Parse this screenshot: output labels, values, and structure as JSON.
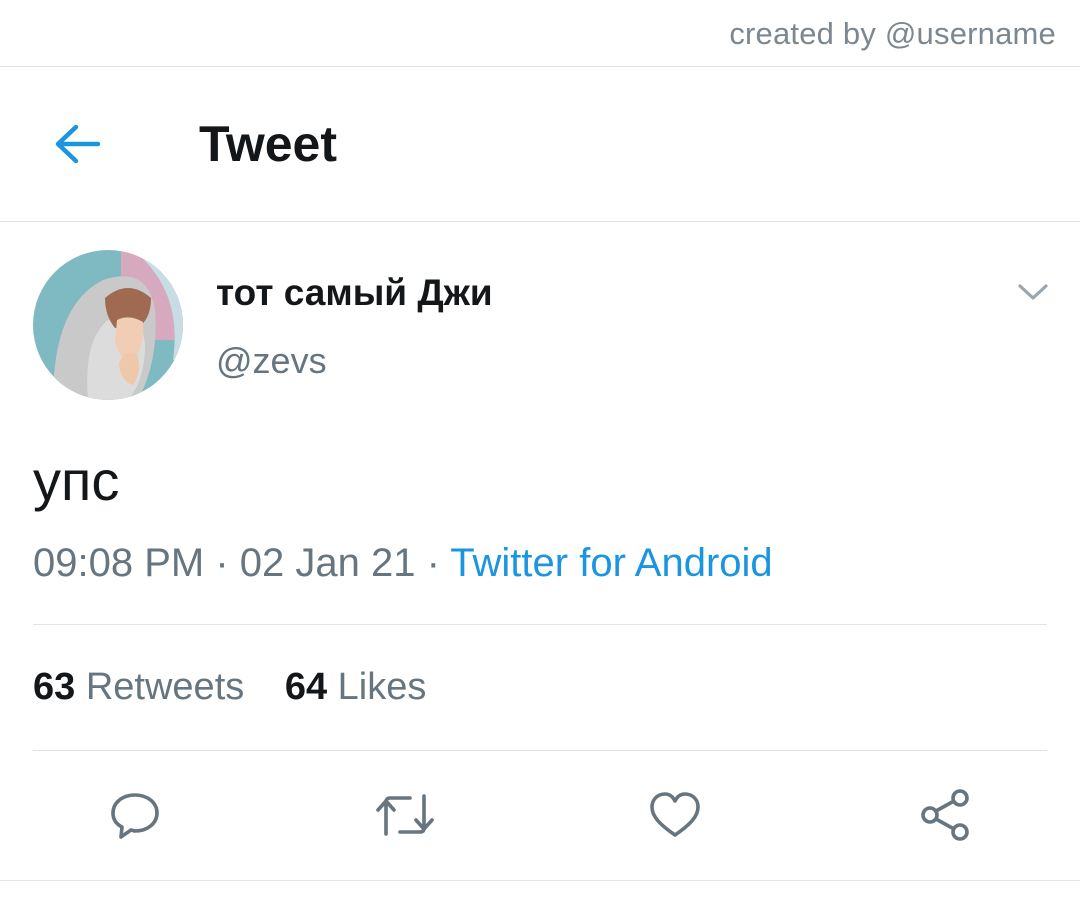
{
  "credit": "created by @username",
  "header": {
    "back_icon": "arrow-left-icon",
    "title": "Tweet"
  },
  "tweet": {
    "author": {
      "display_name": "тот самый Джи",
      "handle": "@zevs",
      "avatar": "profile-photo"
    },
    "text": "упс",
    "time": "09:08 PM",
    "date": "02 Jan 21",
    "separator": " · ",
    "source": "Twitter for Android",
    "retweets_count": "63",
    "retweets_label": "Retweets",
    "likes_count": "64",
    "likes_label": "Likes"
  },
  "actions": [
    {
      "icon": "reply-icon"
    },
    {
      "icon": "retweet-icon"
    },
    {
      "icon": "like-icon"
    },
    {
      "icon": "share-icon"
    }
  ],
  "colors": {
    "accent": "#1b95e0",
    "text_primary": "#14171a",
    "text_secondary": "#66757f",
    "divider": "#e1e4e7"
  }
}
